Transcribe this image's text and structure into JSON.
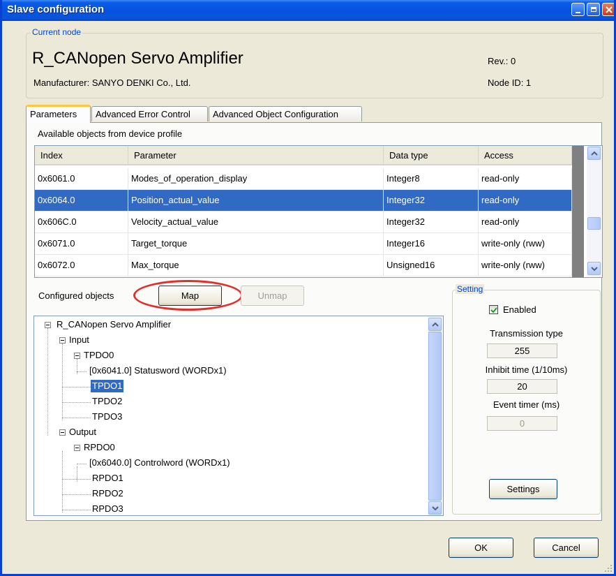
{
  "window": {
    "title": "Slave configuration"
  },
  "current_node": {
    "legend": "Current node",
    "name": "R_CANopen Servo Amplifier",
    "manufacturer": "Manufacturer: SANYO DENKI Co., Ltd.",
    "revision": "Rev.: 0",
    "node_id": "Node ID: 1"
  },
  "tabs": [
    {
      "label": "Parameters",
      "active": true
    },
    {
      "label": "Advanced Error Control",
      "active": false
    },
    {
      "label": "Advanced Object Configuration",
      "active": false
    }
  ],
  "objects": {
    "label": "Available objects from device profile",
    "columns": [
      "Index",
      "Parameter",
      "Data type",
      "Access"
    ],
    "rows": [
      [
        "0x6061.0",
        "Modes_of_operation_display",
        "Integer8",
        "read-only"
      ],
      [
        "0x6064.0",
        "Position_actual_value",
        "Integer32",
        "read-only"
      ],
      [
        "0x606C.0",
        "Velocity_actual_value",
        "Integer32",
        "read-only"
      ],
      [
        "0x6071.0",
        "Target_torque",
        "Integer16",
        "write-only (rww)"
      ],
      [
        "0x6072.0",
        "Max_torque",
        "Unsigned16",
        "write-only (rww)"
      ]
    ],
    "selected_row": 1
  },
  "configured": {
    "label": "Configured objects",
    "map_button": "Map",
    "unmap_button": "Unmap",
    "tree": {
      "root": "R_CANopen Servo Amplifier",
      "input": "Input",
      "tpdo0": "TPDO0",
      "tpdo0_entry": "[0x6041.0] Statusword   (WORDx1)",
      "tpdo1": "TPDO1",
      "tpdo2": "TPDO2",
      "tpdo3": "TPDO3",
      "output": "Output",
      "rpdo0": "RPDO0",
      "rpdo0_entry": "[0x6040.0] Controlword   (WORDx1)",
      "rpdo1": "RPDO1",
      "rpdo2": "RPDO2",
      "rpdo3": "RPDO3"
    },
    "selected": "TPDO1"
  },
  "setting": {
    "legend": "Setting",
    "enabled_label": "Enabled",
    "enabled": true,
    "transmission_type_label": "Transmission type",
    "transmission_type": "255",
    "inhibit_time_label": "Inhibit time (1/10ms)",
    "inhibit_time": "20",
    "event_timer_label": "Event timer (ms)",
    "event_timer": "0",
    "settings_button": "Settings"
  },
  "footer": {
    "ok": "OK",
    "cancel": "Cancel"
  },
  "colors": {
    "selection": "#316ac5",
    "titlebar": "#0553e0",
    "highlight_circle": "#e0302c",
    "legend": "#0046d5"
  }
}
